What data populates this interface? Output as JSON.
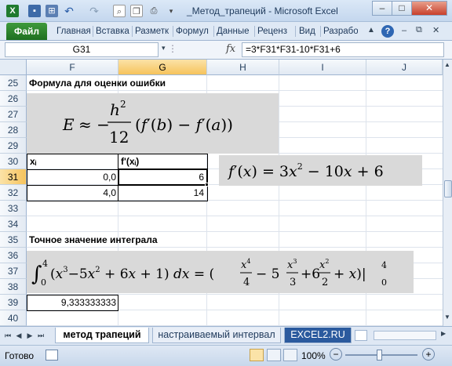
{
  "window": {
    "title": "_Метод_трапеций  -  Microsoft Excel",
    "app_icon": "excel-icon",
    "controls": [
      "minimize-icon",
      "maximize-icon",
      "close-icon"
    ]
  },
  "ribbon": {
    "file_tab": "Файл",
    "tabs": [
      "Главная",
      "Вставка",
      "Разметк",
      "Формул",
      "Данные",
      "Реценз",
      "Вид",
      "Разрабо"
    ]
  },
  "formula_bar": {
    "name_box": "G31",
    "fx_label": "fx",
    "content": "=3*F31*F31-10*F31+6"
  },
  "grid": {
    "columns": [
      "F",
      "G",
      "H",
      "I",
      "J"
    ],
    "selected_column": "G",
    "rows": [
      "25",
      "26",
      "27",
      "28",
      "29",
      "30",
      "31",
      "32",
      "33",
      "34",
      "35",
      "36",
      "37",
      "38",
      "39",
      "40"
    ],
    "selected_row": "31",
    "cells": {
      "F25": "Формула для оценки ошибки",
      "F30": "xᵢ",
      "G30": "f'(xᵢ)",
      "F31": "0,0",
      "G31": "6",
      "F32": "4,0",
      "G32": "14",
      "F35": "Точное значение интеграла",
      "F39": "9,333333333"
    },
    "error_formula_text": "E ≈ −(h²/12)(f′(b) − f′(a))",
    "derivative_formula_text": "f′(x) = 3x² − 10x + 6",
    "integral_formula_text": "∫₀⁴(x³−5x² + 6x + 1) dx = (x⁴/4 − 5 x³/3 + 6 x²/2 + x)|₀⁴"
  },
  "sheets": {
    "tabs": [
      "метод трапеций",
      "настраиваемый интервал",
      "EXCEL2.RU"
    ],
    "active": "метод трапеций"
  },
  "status": {
    "ready": "Готово",
    "zoom": "100%",
    "minus": "−",
    "plus": "+"
  },
  "colors": {
    "excel_green": "#1e7020",
    "selection_orange": "#f6c35c",
    "equation_gray": "#d9d9d9"
  }
}
